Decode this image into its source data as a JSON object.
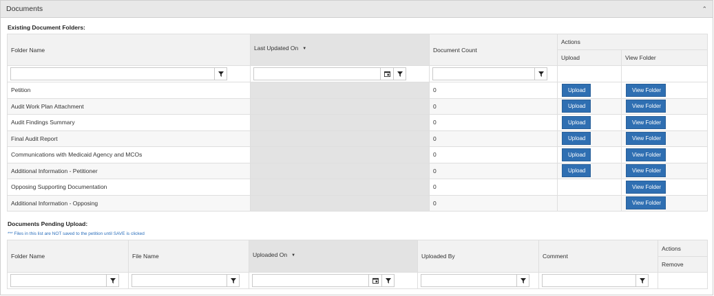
{
  "panel": {
    "title": "Documents"
  },
  "folders_section": {
    "title": "Existing Document Folders:",
    "headers": {
      "folder_name": "Folder Name",
      "last_updated": "Last Updated On",
      "document_count": "Document Count",
      "actions": "Actions",
      "upload": "Upload",
      "view_folder": "View Folder"
    },
    "rows": [
      {
        "name": "Petition",
        "count": "0",
        "upload": "Upload",
        "view": "View Folder"
      },
      {
        "name": "Audit Work Plan Attachment",
        "count": "0",
        "upload": "Upload",
        "view": "View Folder"
      },
      {
        "name": "Audit Findings Summary",
        "count": "0",
        "upload": "Upload",
        "view": "View Folder"
      },
      {
        "name": "Final Audit Report",
        "count": "0",
        "upload": "Upload",
        "view": "View Folder"
      },
      {
        "name": "Communications with Medicaid Agency and MCOs",
        "count": "0",
        "upload": "Upload",
        "view": "View Folder"
      },
      {
        "name": "Additional Information - Petitioner",
        "count": "0",
        "upload": "Upload",
        "view": "View Folder"
      },
      {
        "name": "Opposing Supporting Documentation",
        "count": "0",
        "upload": "",
        "view": "View Folder"
      },
      {
        "name": "Additional Information - Opposing",
        "count": "0",
        "upload": "",
        "view": "View Folder"
      }
    ]
  },
  "pending_section": {
    "title": "Documents Pending Upload:",
    "note": "*** Files in this list are NOT saved to the petition until SAVE is clicked",
    "headers": {
      "folder_name": "Folder Name",
      "file_name": "File Name",
      "uploaded_on": "Uploaded On",
      "uploaded_by": "Uploaded By",
      "comment": "Comment",
      "actions": "Actions",
      "remove": "Remove"
    }
  },
  "icons": {
    "filter": "filter-icon",
    "calendar": "calendar-icon",
    "sort": "sort-desc-icon",
    "collapse": "chevron-up-icon"
  },
  "colors": {
    "button": "#2f6fb2",
    "note": "#2a6ebb",
    "header_bg": "#e8e8e8",
    "sorted_col": "#e3e3e3"
  }
}
